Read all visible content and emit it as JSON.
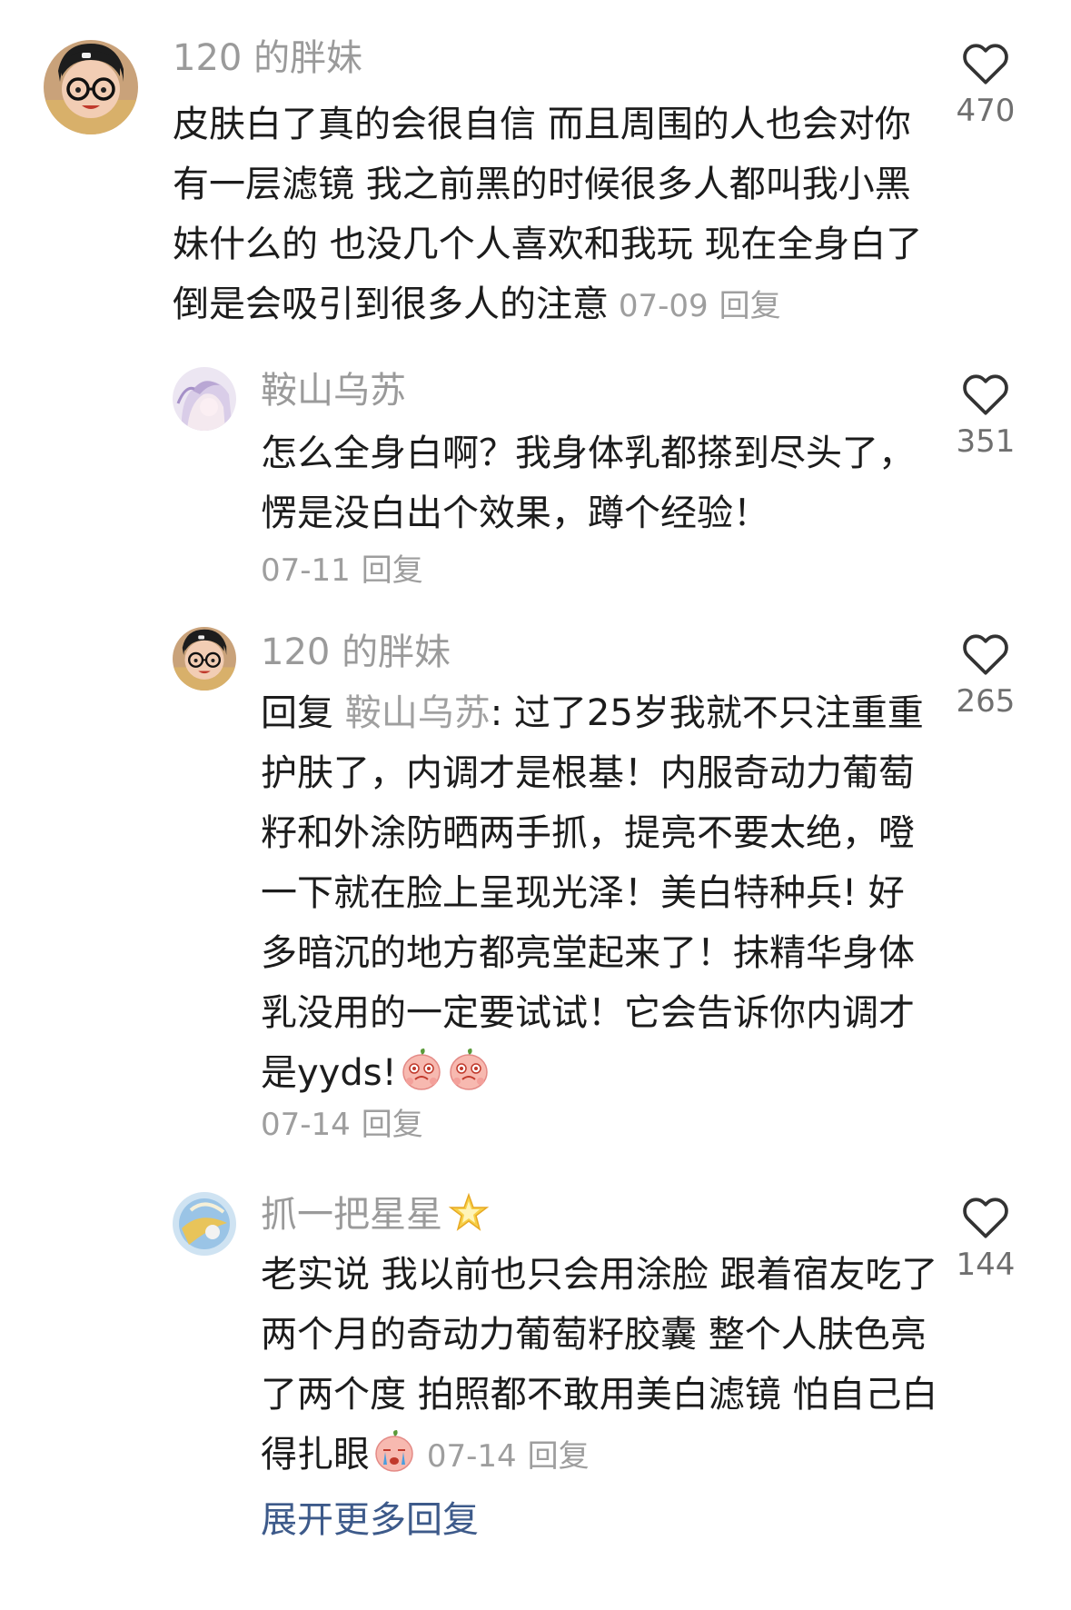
{
  "comments": [
    {
      "username": "120 的胖妹",
      "text": "皮肤白了真的会很自信 而且周围的人也会对你有一层滤镜 我之前黑的时候很多人都叫我小黑妹什么的 也没几个人喜欢和我玩 现在全身白了倒是会吸引到很多人的注意",
      "date": "07-09",
      "reply_label": "回复",
      "likes": "470",
      "avatar_icon": "girl-with-glasses-avatar"
    },
    {
      "username": "鞍山乌苏",
      "text": "怎么全身白啊？我身体乳都搽到尽头了，愣是没白出个效果，蹲个经验！",
      "date": "07-11",
      "reply_label": "回复",
      "likes": "351",
      "avatar_icon": "anime-girl-avatar"
    },
    {
      "username": "120 的胖妹",
      "reply_prefix": "回复",
      "mention": "鞍山乌苏",
      "text": ": 过了25岁我就不只注重重护肤了，内调才是根基！内服奇动力葡萄籽和外涂防晒两手抓，提亮不要太绝，噔一下就在脸上呈现光泽！美白特种兵! 好多暗沉的地方都亮堂起来了！抹精华身体乳没用的一定要试试！它会告诉你内调才是yyds!",
      "date": "07-14",
      "reply_label": "回复",
      "likes": "265",
      "avatar_icon": "girl-with-glasses-avatar"
    },
    {
      "username": "抓一把星星",
      "text": "老实说 我以前也只会用涂脸 跟着宿友吃了两个月的奇动力葡萄籽胶囊 整个人肤色亮了两个度 拍照都不敢用美白滤镜 怕自己白得扎眼",
      "date": "07-14",
      "reply_label": "回复",
      "likes": "144",
      "avatar_icon": "blue-art-avatar"
    }
  ],
  "expand_label": "展开更多回复",
  "colors": {
    "username": "#9a9a9a",
    "body": "#1c1c1c",
    "meta": "#9e9e9e",
    "expand_link": "#3d5a8a",
    "like_icon": "#333333"
  }
}
